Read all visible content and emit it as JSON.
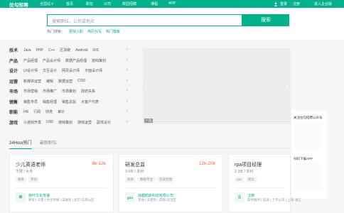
{
  "topbar": {
    "logo": "拉勾招聘",
    "city": "全国站 ▾",
    "nav": [
      "首页",
      "职位",
      "公司",
      "校园招聘",
      "课程",
      "APP"
    ],
    "login": "登录",
    "register": "注册",
    "company": "进入企业版",
    "bg": "#00b38a"
  },
  "search": {
    "placeholder": "搜索职位、公司或地点",
    "button": "搜索",
    "hot_label": "热门搜索：",
    "hot": [
      "更快入职",
      "简历代写",
      "热门模板"
    ]
  },
  "categories": [
    {
      "title": "技术",
      "items": [
        "Java",
        "PHP",
        "C++",
        "区块链",
        "Android",
        "iOS"
      ]
    },
    {
      "title": "产品",
      "items": [
        "产品经理",
        "产品设计师",
        "数据产品经理",
        "游戏策划"
      ]
    },
    {
      "title": "设计",
      "items": [
        "UI设计师",
        "交互设计",
        "网页设计师",
        "平面设计师"
      ]
    },
    {
      "title": "运营",
      "items": [
        "新媒体运营",
        "编辑",
        "数据运营",
        "COO"
      ]
    },
    {
      "title": "市场",
      "items": [
        "市场营销",
        "市场推广",
        "市场策划",
        "政府关系"
      ]
    },
    {
      "title": "销售",
      "items": [
        "销售专员",
        "销售经理",
        "销售总监",
        "大客户代表"
      ]
    },
    {
      "title": "职能",
      "items": [
        "HR",
        "行政",
        "财务",
        "审计"
      ]
    },
    {
      "title": "游戏",
      "items": [
        "小游戏开发",
        "U3D",
        "游戏策划",
        "游戏运营",
        "副驾设计"
      ]
    }
  ],
  "banner": {
    "tag": "广告",
    "prev": "‹",
    "next": "›"
  },
  "sidebar": {
    "follow_label": "关注拉勾招聘公众号",
    "app_label": "扫码下载APP"
  },
  "tabs": [
    "24Hour热门",
    "最新职位"
  ],
  "jobs": [
    {
      "title": "少儿英语老师",
      "salary": "8k-12k",
      "meta": "不限 / 大专",
      "tags": [
        "教育",
        "英语"
      ],
      "logo": "荷",
      "company": "荷叶文化传播",
      "info": "教育 | 天使 | 文化传媒 | 未融资 | 北京·石景山区"
    },
    {
      "title": "研发总监",
      "salary": "12k-20k",
      "meta": "3-5年 / 本科",
      "tags": [
        "研发",
        "数据平台",
        "开发经理"
      ],
      "logo": "gsn",
      "company": "成都鸥斯科技有限公司",
      "info": "其他 | 天使轮 | 成都·双流区"
    },
    {
      "title": "rpa项目经理",
      "salary": "",
      "meta": "1-3年 / 本科",
      "tags": [
        "rpa",
        "测试"
      ],
      "logo": "汪",
      "company": "汪微",
      "info": "软件服务 | 前海 | 上市公司 | 上海·浦江"
    }
  ]
}
